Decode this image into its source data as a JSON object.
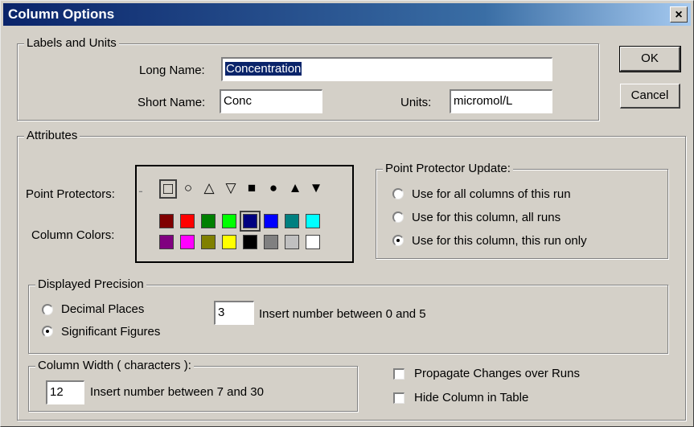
{
  "window": {
    "title": "Column Options",
    "close_label": "×"
  },
  "labels_units": {
    "group_label": "Labels and Units",
    "long_name_label": "Long Name:",
    "long_name_value": "Concentration",
    "short_name_label": "Short Name:",
    "short_name_value": "Conc",
    "units_label": "Units:",
    "units_value": "micromol/L"
  },
  "buttons": {
    "ok": "OK",
    "cancel": "Cancel"
  },
  "attributes": {
    "group_label": "Attributes",
    "point_protectors_label": "Point Protectors:",
    "column_colors_label": "Column Colors:",
    "symbols": [
      {
        "name": "none",
        "glyph": "-"
      },
      {
        "name": "open-square",
        "glyph": "□",
        "selected": true
      },
      {
        "name": "open-circle",
        "glyph": "○"
      },
      {
        "name": "open-triangle-up",
        "glyph": "△"
      },
      {
        "name": "open-triangle-down",
        "glyph": "▽"
      },
      {
        "name": "filled-square",
        "glyph": "■"
      },
      {
        "name": "filled-circle",
        "glyph": "●"
      },
      {
        "name": "filled-triangle-up",
        "glyph": "▲"
      },
      {
        "name": "filled-triangle-down",
        "glyph": "▼"
      }
    ],
    "colors_row1": [
      "#800000",
      "#ff0000",
      "#008000",
      "#00ff00",
      "#000080",
      "#0000ff",
      "#008080",
      "#00ffff"
    ],
    "colors_row2": [
      "#800080",
      "#ff00ff",
      "#808000",
      "#ffff00",
      "#000000",
      "#808080",
      "#c0c0c0",
      "#ffffff"
    ],
    "selected_color": "#000080",
    "update": {
      "group_label": "Point Protector Update:",
      "options": [
        {
          "label": "Use for all columns of this run",
          "checked": false
        },
        {
          "label": "Use for this column, all runs",
          "checked": false
        },
        {
          "label": "Use for this column, this run only",
          "checked": true
        }
      ]
    },
    "precision": {
      "group_label": "Displayed Precision",
      "options": [
        {
          "label": "Decimal Places",
          "checked": false
        },
        {
          "label": "Significant Figures",
          "checked": true
        }
      ],
      "value": "3",
      "hint": "Insert number between 0 and 5"
    },
    "width": {
      "group_label": "Column Width ( characters ):",
      "value": "12",
      "hint": "Insert number between 7 and 30"
    },
    "checkboxes": [
      {
        "label": "Propagate Changes over Runs",
        "checked": false
      },
      {
        "label": "Hide Column in Table",
        "checked": false
      }
    ]
  }
}
